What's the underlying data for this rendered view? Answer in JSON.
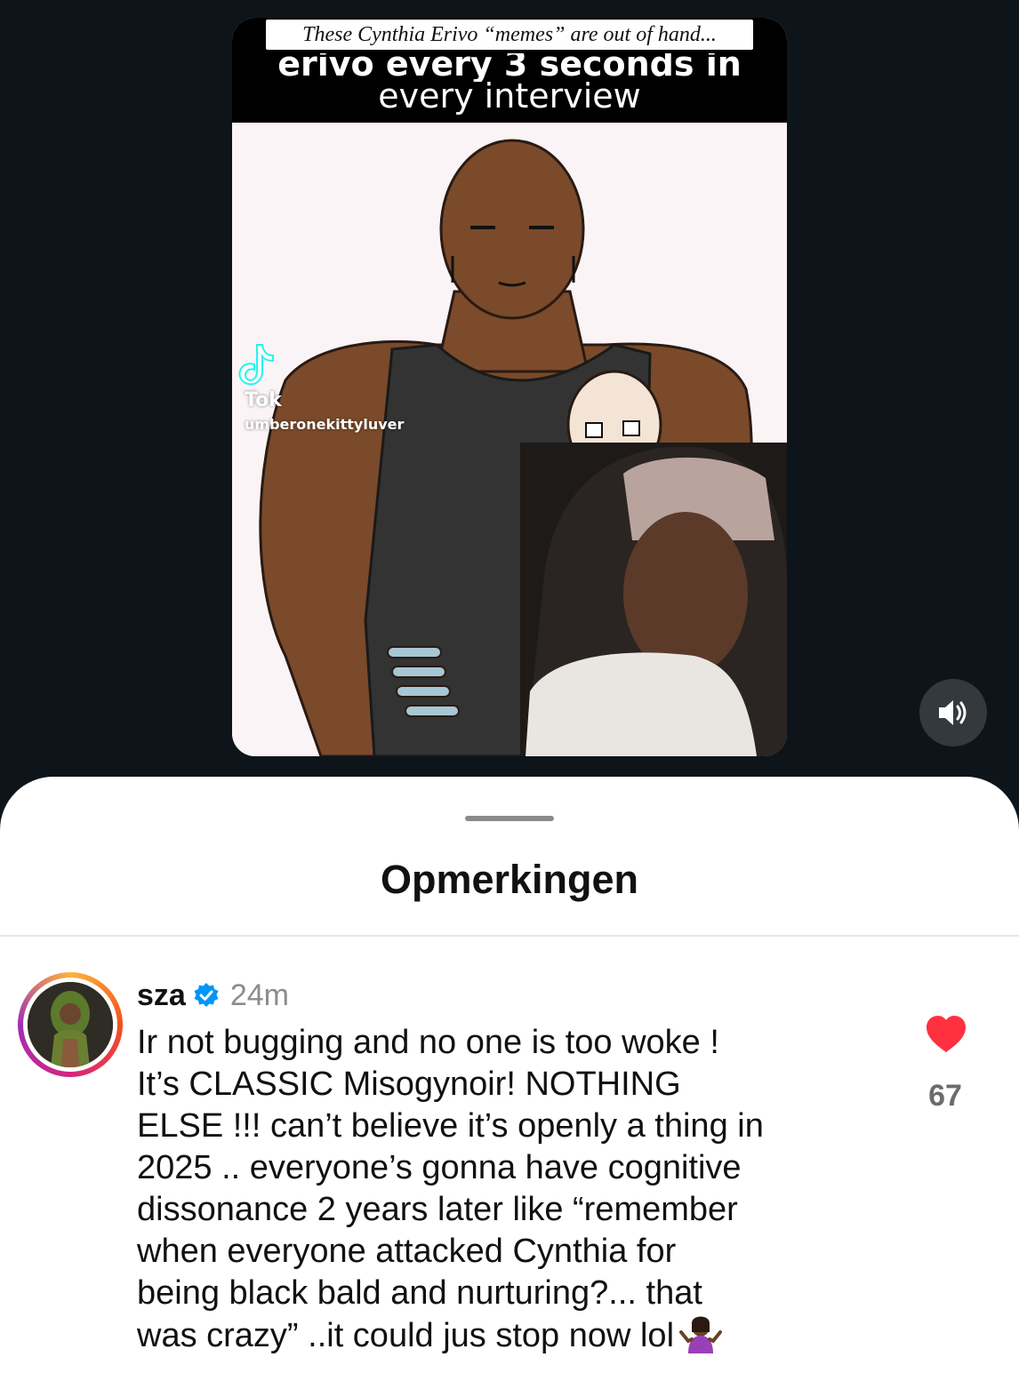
{
  "post": {
    "caption_banner": "These Cynthia Erivo “memes” are out of hand...",
    "header_text": "every interview",
    "watermark_brand": "Tok",
    "watermark_handle": "umberonekittyluver"
  },
  "sheet": {
    "title": "Opmerkingen"
  },
  "comment": {
    "username": "sza",
    "time": "24m",
    "text": "Ir not bugging and no one is too woke !\nIt’s CLASSIC Misogynoir! NOTHING\nELSE !!! can’t believe it’s openly a thing in\n2025 .. everyone’s gonna have cognitive\ndissonance 2 years later like “remember\nwhen everyone attacked Cynthia for\nbeing black bald and nurturing?... that\nwas crazy” ..it could jus stop now lol",
    "likes": "67"
  },
  "icons": {
    "volume": "volume-icon",
    "verified": "verified-icon",
    "like": "heart-icon",
    "emoji": "shrug-emoji-icon"
  },
  "colors": {
    "background_dark": "#0d151b",
    "heart_red": "#ff3040",
    "verified_blue": "#0095f6"
  }
}
